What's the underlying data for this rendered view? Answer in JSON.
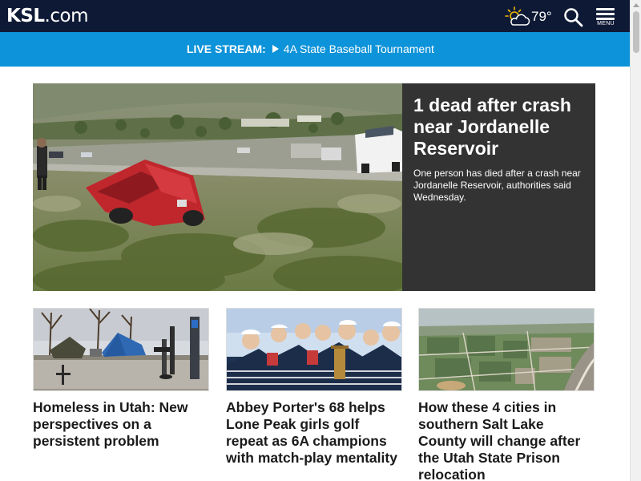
{
  "header": {
    "logo_main": "KSL",
    "logo_suffix": ".com",
    "weather_icon": "partly-cloudy-icon",
    "temperature": "79°",
    "search_icon": "search-icon",
    "menu_label": "MENU"
  },
  "live_stream": {
    "label": "LIVE STREAM:",
    "icon": "play-icon",
    "title": "4A State Baseball Tournament"
  },
  "hero": {
    "title": "1 dead after crash near Jordanelle Reservoir",
    "description": "One person has died after a crash near Jordanelle Reservoir, authorities said Wednesday."
  },
  "cards": [
    {
      "title": "Homeless in Utah: New perspectives on a persistent problem"
    },
    {
      "title": "Abbey Porter's 68 helps Lone Peak girls golf repeat as 6A champions with match-play mentality"
    },
    {
      "title": "How these 4 cities in southern Salt Lake County will change after the Utah State Prison relocation"
    }
  ],
  "colors": {
    "header_bg": "#0e1a35",
    "live_bg": "#0d93d9",
    "hero_panel_bg": "#333333"
  }
}
